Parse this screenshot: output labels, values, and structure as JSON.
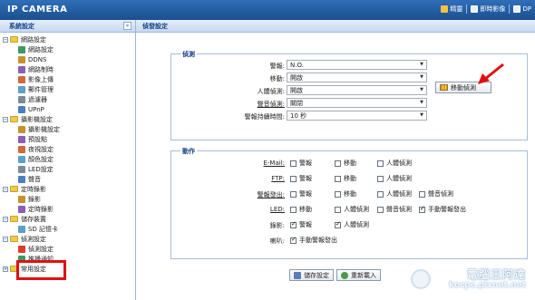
{
  "app": {
    "title": "IP CAMERA",
    "actions": [
      {
        "label": "精靈",
        "icon": "wizard-icon"
      },
      {
        "label": "即時影像",
        "icon": "live-view-icon"
      },
      {
        "label": "DP",
        "icon": "document-icon"
      }
    ]
  },
  "sidebar": {
    "title": "系統設定",
    "collapse_glyph": "«",
    "items": [
      {
        "label": "網路設定",
        "level": 0,
        "expanded": true
      },
      {
        "label": "網路設定",
        "level": 1,
        "icon": "network-settings-icon"
      },
      {
        "label": "DDNS",
        "level": 1,
        "icon": "ddns-icon"
      },
      {
        "label": "網路制時",
        "level": 1,
        "icon": "time-sync-icon"
      },
      {
        "label": "影像上傳",
        "level": 1,
        "icon": "image-upload-icon"
      },
      {
        "label": "郵件管理",
        "level": 1,
        "icon": "mail-icon"
      },
      {
        "label": "過濾器",
        "level": 1,
        "icon": "filter-icon"
      },
      {
        "label": "UPnP",
        "level": 1,
        "icon": "upnp-icon"
      },
      {
        "label": "攝影機設定",
        "level": 0,
        "expanded": true
      },
      {
        "label": "攝影機設定",
        "level": 1,
        "icon": "camera-icon"
      },
      {
        "label": "預設點",
        "level": 1,
        "icon": "preset-icon"
      },
      {
        "label": "夜視設定",
        "level": 1,
        "icon": "night-vision-icon"
      },
      {
        "label": "顏色設定",
        "level": 1,
        "icon": "color-icon"
      },
      {
        "label": "LED設定",
        "level": 1,
        "icon": "led-icon"
      },
      {
        "label": "聲音",
        "level": 1,
        "icon": "sound-icon"
      },
      {
        "label": "定時錄影",
        "level": 0,
        "expanded": true
      },
      {
        "label": "錄影",
        "level": 1,
        "icon": "record-icon"
      },
      {
        "label": "定時錄影",
        "level": 1,
        "icon": "schedule-icon"
      },
      {
        "label": "儲存裝置",
        "level": 0,
        "expanded": true
      },
      {
        "label": "SD 記憶卡",
        "level": 1,
        "icon": "sd-card-icon"
      },
      {
        "label": "偵測設定",
        "level": 0,
        "expanded": true
      },
      {
        "label": "偵測設定",
        "level": 1,
        "icon": "detection-icon",
        "selected": true
      },
      {
        "label": "推播通知",
        "level": 1,
        "icon": "push-icon"
      },
      {
        "label": "常用設定",
        "level": 0,
        "expanded": false
      }
    ]
  },
  "main": {
    "title": "偵發設定",
    "detection": {
      "title": "偵測",
      "fields": [
        {
          "label": "警報:",
          "value": "N.O.",
          "underline": false
        },
        {
          "label": "移動:",
          "value": "開啟",
          "underline": false
        },
        {
          "label": "人體偵測:",
          "value": "開啟",
          "underline": false
        },
        {
          "label": "聲音偵測:",
          "value": "關閉",
          "underline": true
        },
        {
          "label": "警報持續時間:",
          "value": "10 秒",
          "underline": false
        }
      ],
      "motion_button": "移動偵測"
    },
    "actions": {
      "title": "動作",
      "rows": [
        {
          "label": "E-Mail:",
          "underline": true,
          "options": [
            {
              "label": "警報",
              "checked": false
            },
            {
              "label": "移動",
              "checked": false
            },
            {
              "label": "人體偵測",
              "checked": false
            }
          ]
        },
        {
          "label": "FTP:",
          "underline": true,
          "options": [
            {
              "label": "警報",
              "checked": false
            },
            {
              "label": "移動",
              "checked": false
            },
            {
              "label": "人體偵測",
              "checked": false
            }
          ]
        },
        {
          "label": "警報發出:",
          "underline": true,
          "options": [
            {
              "label": "警報",
              "checked": false
            },
            {
              "label": "移動",
              "checked": false
            },
            {
              "label": "人體偵測",
              "checked": false
            },
            {
              "label": "聲音偵測",
              "checked": false
            }
          ]
        },
        {
          "label": "LED:",
          "underline": true,
          "options": [
            {
              "label": "移動",
              "checked": false
            },
            {
              "label": "人體偵測",
              "checked": false
            },
            {
              "label": "聲音偵測",
              "checked": false
            },
            {
              "label": "手動警報發出",
              "checked": true
            }
          ]
        },
        {
          "label": "錄影:",
          "underline": false,
          "options": [
            {
              "label": "警報",
              "checked": true
            },
            {
              "label": "人體偵測",
              "checked": true
            }
          ]
        },
        {
          "label": "喇叭:",
          "underline": false,
          "options": [
            {
              "label": "手動警報發出",
              "checked": true
            }
          ]
        }
      ]
    },
    "save_label": "儲存設定",
    "reload_label": "重新載入"
  },
  "watermark": {
    "text": "電腦王阿達",
    "url": "kocpc.pixnet.net"
  },
  "colors": {
    "topbar": "#1b4f8f",
    "header_text": "#15428b",
    "highlight": "#e01010"
  }
}
